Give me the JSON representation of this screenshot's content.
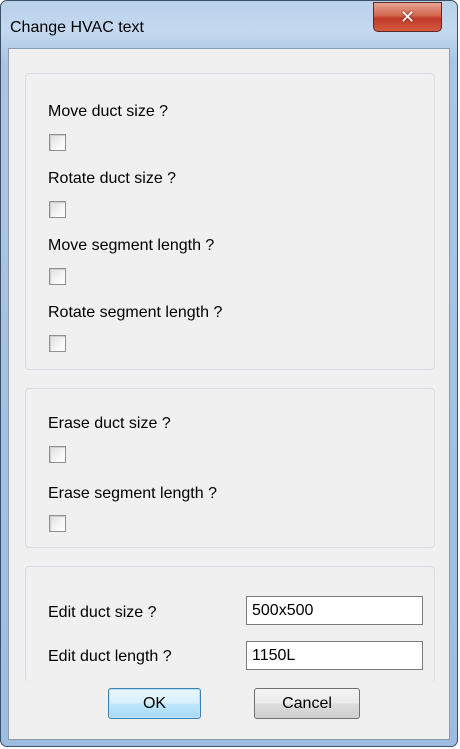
{
  "window": {
    "title": "Change HVAC text",
    "close_glyph": "✕"
  },
  "group_move_rotate": {
    "items": [
      {
        "label": "Move duct size ?",
        "checked": false
      },
      {
        "label": "Rotate duct size ?",
        "checked": false
      },
      {
        "label": "Move segment length ?",
        "checked": false
      },
      {
        "label": "Rotate segment length ?",
        "checked": false
      }
    ]
  },
  "group_erase": {
    "items": [
      {
        "label": "Erase duct size ?",
        "checked": false
      },
      {
        "label": "Erase segment length ?",
        "checked": false
      }
    ]
  },
  "group_edit": {
    "duct_size_label": "Edit duct size ?",
    "duct_size_value": "500x500",
    "duct_length_label": "Edit duct length ?",
    "duct_length_value": "1150L"
  },
  "buttons": {
    "ok_label": "OK",
    "cancel_label": "Cancel"
  },
  "colors": {
    "frame_accent": "#9dbde0",
    "close_button": "#c0392a",
    "default_button_border": "#3c7fb1"
  }
}
